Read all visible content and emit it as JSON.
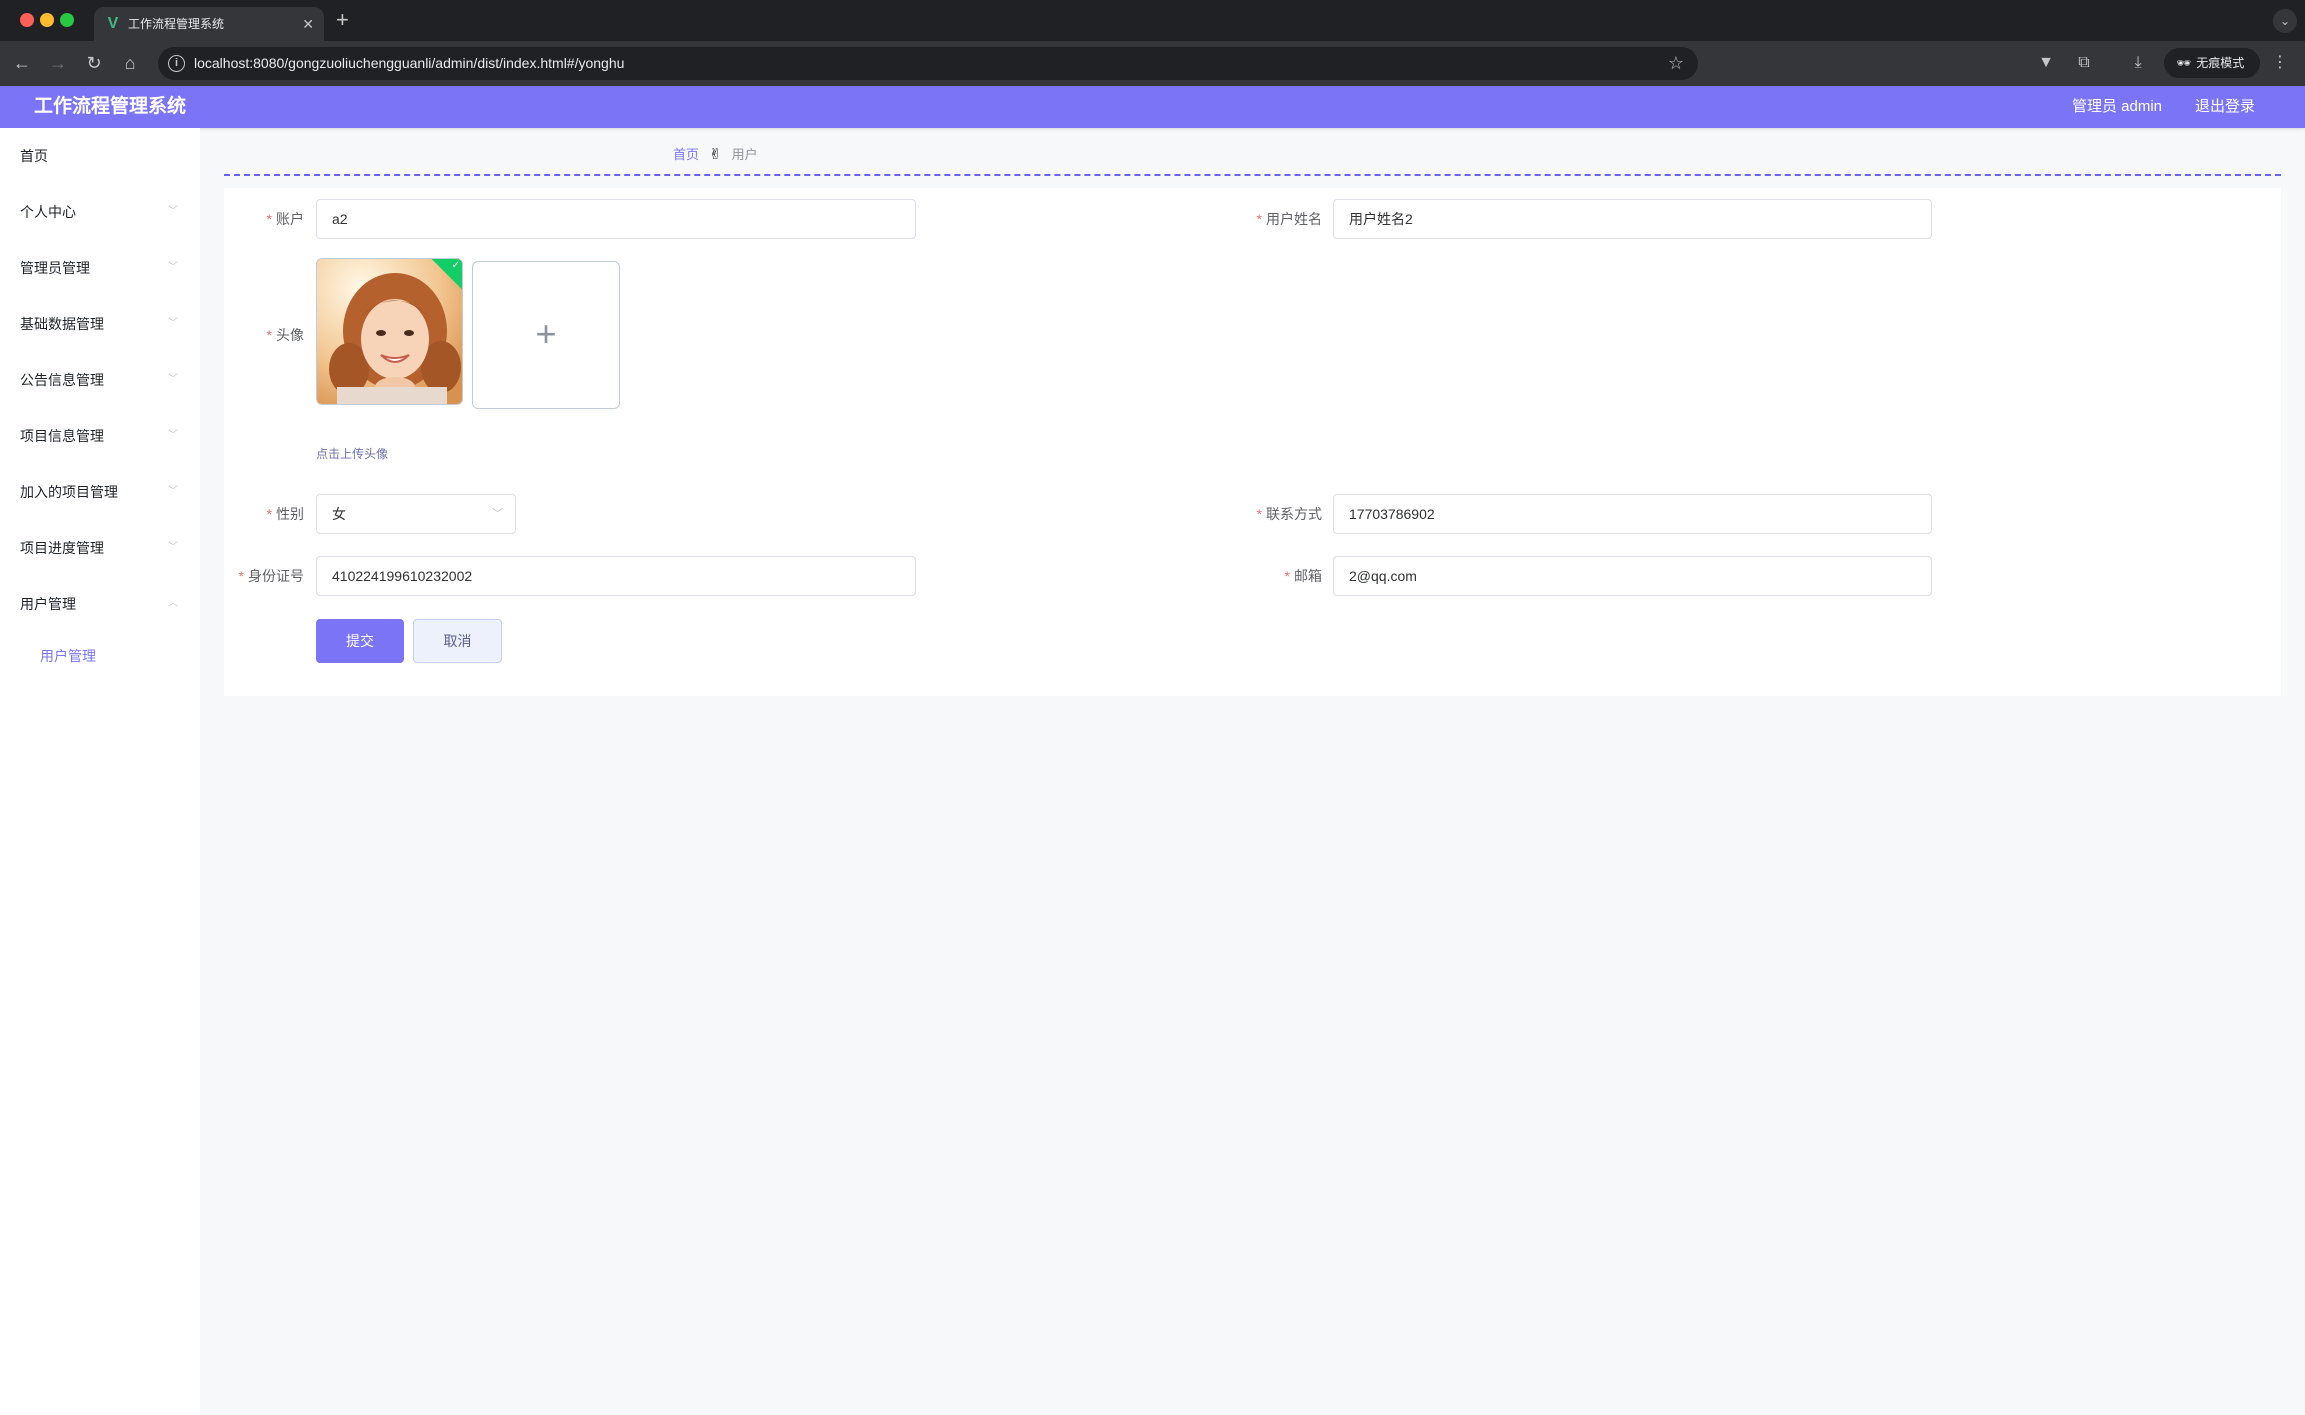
{
  "browser": {
    "tab_title": "工作流程管理系统",
    "tab_close": "✕",
    "new_tab": "+",
    "url": "localhost:8080/gongzuoliuchengguanli/admin/dist/index.html#/yonghu",
    "incognito_label": "无痕模式",
    "icons": [
      "vue-favicon-icon",
      "back-icon",
      "forward-icon",
      "reload-icon",
      "home-icon",
      "site-info-icon",
      "bookmark-star-icon",
      "extension-v-icon",
      "extensions-puzzle-icon",
      "download-icon",
      "incognito-icon",
      "menu-kebab-icon",
      "tab-search-icon"
    ]
  },
  "header": {
    "title": "工作流程管理系统",
    "user": "管理员 admin",
    "logout": "退出登录",
    "background": "#7b74f7"
  },
  "sidebar": {
    "items": [
      {
        "label": "首页",
        "has_arrow": false
      },
      {
        "label": "个人中心",
        "has_arrow": true
      },
      {
        "label": "管理员管理",
        "has_arrow": true
      },
      {
        "label": "基础数据管理",
        "has_arrow": true
      },
      {
        "label": "公告信息管理",
        "has_arrow": true
      },
      {
        "label": "项目信息管理",
        "has_arrow": true
      },
      {
        "label": "加入的项目管理",
        "has_arrow": true
      },
      {
        "label": "项目进度管理",
        "has_arrow": true
      },
      {
        "label": "用户管理",
        "has_arrow": true,
        "expanded": true
      }
    ],
    "submenu": {
      "label": "用户管理",
      "active": true,
      "color": "#7b74f7"
    }
  },
  "breadcrumb": {
    "home": "首页",
    "separator": "✌",
    "current": "用户"
  },
  "form": {
    "account": {
      "label": "账户",
      "value": "a2"
    },
    "name": {
      "label": "用户姓名",
      "value": "用户姓名2"
    },
    "avatar": {
      "label": "头像",
      "upload_tip": "点击上传头像",
      "add_symbol": "+",
      "uploaded_check": "✓"
    },
    "gender": {
      "label": "性别",
      "value": "女"
    },
    "phone": {
      "label": "联系方式",
      "value": "17703786902"
    },
    "idcard": {
      "label": "身份证号",
      "value": "410224199610232002"
    },
    "email": {
      "label": "邮箱",
      "value": "2@qq.com"
    },
    "submit": "提交",
    "cancel": "取消"
  }
}
